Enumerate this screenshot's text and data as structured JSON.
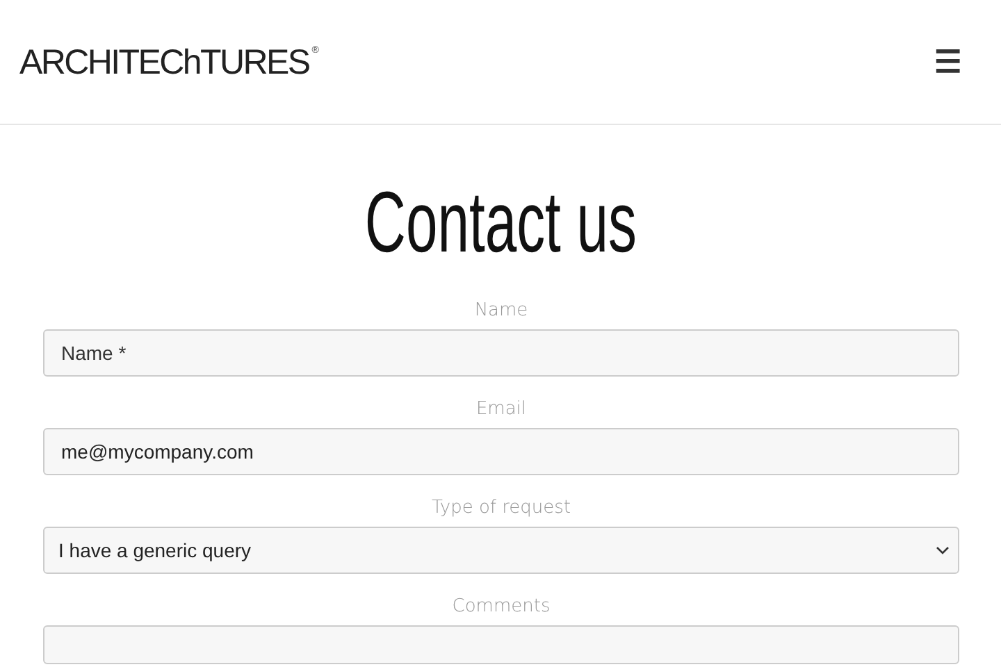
{
  "header": {
    "logo": "ARCHITEChTURES",
    "logo_mark": "®",
    "menu_icon": "☰"
  },
  "title": "Contact us",
  "fields": [
    {
      "kind": "text",
      "label": "Name",
      "placeholder": "Name *"
    },
    {
      "kind": "text",
      "label": "Email",
      "value": "me@mycompany.com"
    },
    {
      "kind": "select",
      "label": "Type of request",
      "value": "I have a generic query"
    },
    {
      "kind": "textarea",
      "label": "Comments"
    }
  ]
}
